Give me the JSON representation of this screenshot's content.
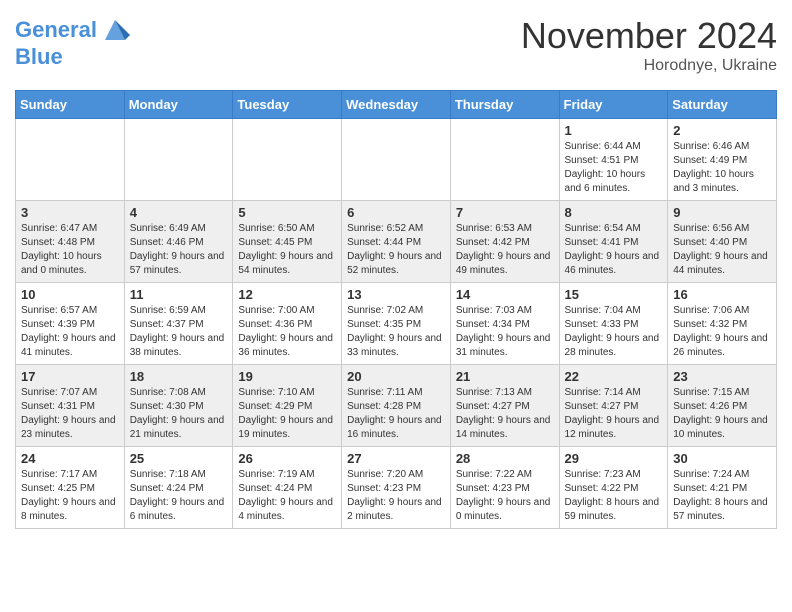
{
  "header": {
    "logo_line1": "General",
    "logo_line2": "Blue",
    "month_title": "November 2024",
    "location": "Horodnye, Ukraine"
  },
  "days_of_week": [
    "Sunday",
    "Monday",
    "Tuesday",
    "Wednesday",
    "Thursday",
    "Friday",
    "Saturday"
  ],
  "weeks": [
    [
      {
        "day": "",
        "info": ""
      },
      {
        "day": "",
        "info": ""
      },
      {
        "day": "",
        "info": ""
      },
      {
        "day": "",
        "info": ""
      },
      {
        "day": "",
        "info": ""
      },
      {
        "day": "1",
        "info": "Sunrise: 6:44 AM\nSunset: 4:51 PM\nDaylight: 10 hours and 6 minutes."
      },
      {
        "day": "2",
        "info": "Sunrise: 6:46 AM\nSunset: 4:49 PM\nDaylight: 10 hours and 3 minutes."
      }
    ],
    [
      {
        "day": "3",
        "info": "Sunrise: 6:47 AM\nSunset: 4:48 PM\nDaylight: 10 hours and 0 minutes."
      },
      {
        "day": "4",
        "info": "Sunrise: 6:49 AM\nSunset: 4:46 PM\nDaylight: 9 hours and 57 minutes."
      },
      {
        "day": "5",
        "info": "Sunrise: 6:50 AM\nSunset: 4:45 PM\nDaylight: 9 hours and 54 minutes."
      },
      {
        "day": "6",
        "info": "Sunrise: 6:52 AM\nSunset: 4:44 PM\nDaylight: 9 hours and 52 minutes."
      },
      {
        "day": "7",
        "info": "Sunrise: 6:53 AM\nSunset: 4:42 PM\nDaylight: 9 hours and 49 minutes."
      },
      {
        "day": "8",
        "info": "Sunrise: 6:54 AM\nSunset: 4:41 PM\nDaylight: 9 hours and 46 minutes."
      },
      {
        "day": "9",
        "info": "Sunrise: 6:56 AM\nSunset: 4:40 PM\nDaylight: 9 hours and 44 minutes."
      }
    ],
    [
      {
        "day": "10",
        "info": "Sunrise: 6:57 AM\nSunset: 4:39 PM\nDaylight: 9 hours and 41 minutes."
      },
      {
        "day": "11",
        "info": "Sunrise: 6:59 AM\nSunset: 4:37 PM\nDaylight: 9 hours and 38 minutes."
      },
      {
        "day": "12",
        "info": "Sunrise: 7:00 AM\nSunset: 4:36 PM\nDaylight: 9 hours and 36 minutes."
      },
      {
        "day": "13",
        "info": "Sunrise: 7:02 AM\nSunset: 4:35 PM\nDaylight: 9 hours and 33 minutes."
      },
      {
        "day": "14",
        "info": "Sunrise: 7:03 AM\nSunset: 4:34 PM\nDaylight: 9 hours and 31 minutes."
      },
      {
        "day": "15",
        "info": "Sunrise: 7:04 AM\nSunset: 4:33 PM\nDaylight: 9 hours and 28 minutes."
      },
      {
        "day": "16",
        "info": "Sunrise: 7:06 AM\nSunset: 4:32 PM\nDaylight: 9 hours and 26 minutes."
      }
    ],
    [
      {
        "day": "17",
        "info": "Sunrise: 7:07 AM\nSunset: 4:31 PM\nDaylight: 9 hours and 23 minutes."
      },
      {
        "day": "18",
        "info": "Sunrise: 7:08 AM\nSunset: 4:30 PM\nDaylight: 9 hours and 21 minutes."
      },
      {
        "day": "19",
        "info": "Sunrise: 7:10 AM\nSunset: 4:29 PM\nDaylight: 9 hours and 19 minutes."
      },
      {
        "day": "20",
        "info": "Sunrise: 7:11 AM\nSunset: 4:28 PM\nDaylight: 9 hours and 16 minutes."
      },
      {
        "day": "21",
        "info": "Sunrise: 7:13 AM\nSunset: 4:27 PM\nDaylight: 9 hours and 14 minutes."
      },
      {
        "day": "22",
        "info": "Sunrise: 7:14 AM\nSunset: 4:27 PM\nDaylight: 9 hours and 12 minutes."
      },
      {
        "day": "23",
        "info": "Sunrise: 7:15 AM\nSunset: 4:26 PM\nDaylight: 9 hours and 10 minutes."
      }
    ],
    [
      {
        "day": "24",
        "info": "Sunrise: 7:17 AM\nSunset: 4:25 PM\nDaylight: 9 hours and 8 minutes."
      },
      {
        "day": "25",
        "info": "Sunrise: 7:18 AM\nSunset: 4:24 PM\nDaylight: 9 hours and 6 minutes."
      },
      {
        "day": "26",
        "info": "Sunrise: 7:19 AM\nSunset: 4:24 PM\nDaylight: 9 hours and 4 minutes."
      },
      {
        "day": "27",
        "info": "Sunrise: 7:20 AM\nSunset: 4:23 PM\nDaylight: 9 hours and 2 minutes."
      },
      {
        "day": "28",
        "info": "Sunrise: 7:22 AM\nSunset: 4:23 PM\nDaylight: 9 hours and 0 minutes."
      },
      {
        "day": "29",
        "info": "Sunrise: 7:23 AM\nSunset: 4:22 PM\nDaylight: 8 hours and 59 minutes."
      },
      {
        "day": "30",
        "info": "Sunrise: 7:24 AM\nSunset: 4:21 PM\nDaylight: 8 hours and 57 minutes."
      }
    ]
  ]
}
